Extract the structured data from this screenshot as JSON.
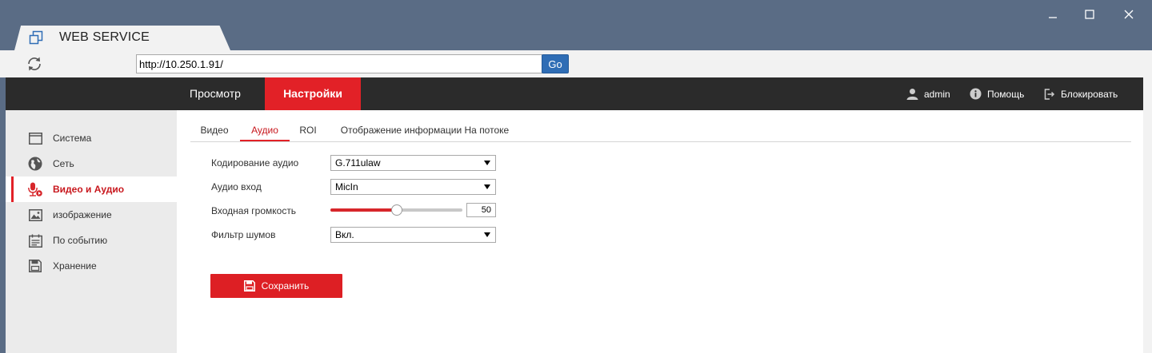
{
  "browser": {
    "tab_title": "WEB SERVICE",
    "url": "http://10.250.1.91/",
    "go_label": "Go"
  },
  "topnav": {
    "view_label": "Просмотр",
    "settings_label": "Настройки",
    "user_label": "admin",
    "help_label": "Помощь",
    "lock_label": "Блокировать"
  },
  "sidebar": {
    "items": [
      {
        "label": "Система",
        "icon": "monitor-icon"
      },
      {
        "label": "Сеть",
        "icon": "globe-icon"
      },
      {
        "label": "Видео и Аудио",
        "icon": "microphone-icon",
        "active": true
      },
      {
        "label": "изображение",
        "icon": "image-icon"
      },
      {
        "label": "По событию",
        "icon": "calendar-icon"
      },
      {
        "label": "Хранение",
        "icon": "disk-icon"
      }
    ]
  },
  "subtabs": [
    {
      "label": "Видео"
    },
    {
      "label": "Аудио",
      "active": true
    },
    {
      "label": "ROI"
    },
    {
      "label": "Отображение информации На потоке"
    }
  ],
  "form": {
    "encoding_label": "Кодирование аудио",
    "encoding_value": "G.711ulaw",
    "input_label": "Аудио вход",
    "input_value": "MicIn",
    "volume_label": "Входная громкость",
    "volume_value": "50",
    "volume_fraction": 0.5,
    "noise_label": "Фильтр шумов",
    "noise_value": "Вкл."
  },
  "save_label": "Сохранить",
  "colors": {
    "accent": "#e22127",
    "nav_bg": "#2b2b2b",
    "chrome_bg": "#5a6c85",
    "go_button": "#2f6db5"
  }
}
